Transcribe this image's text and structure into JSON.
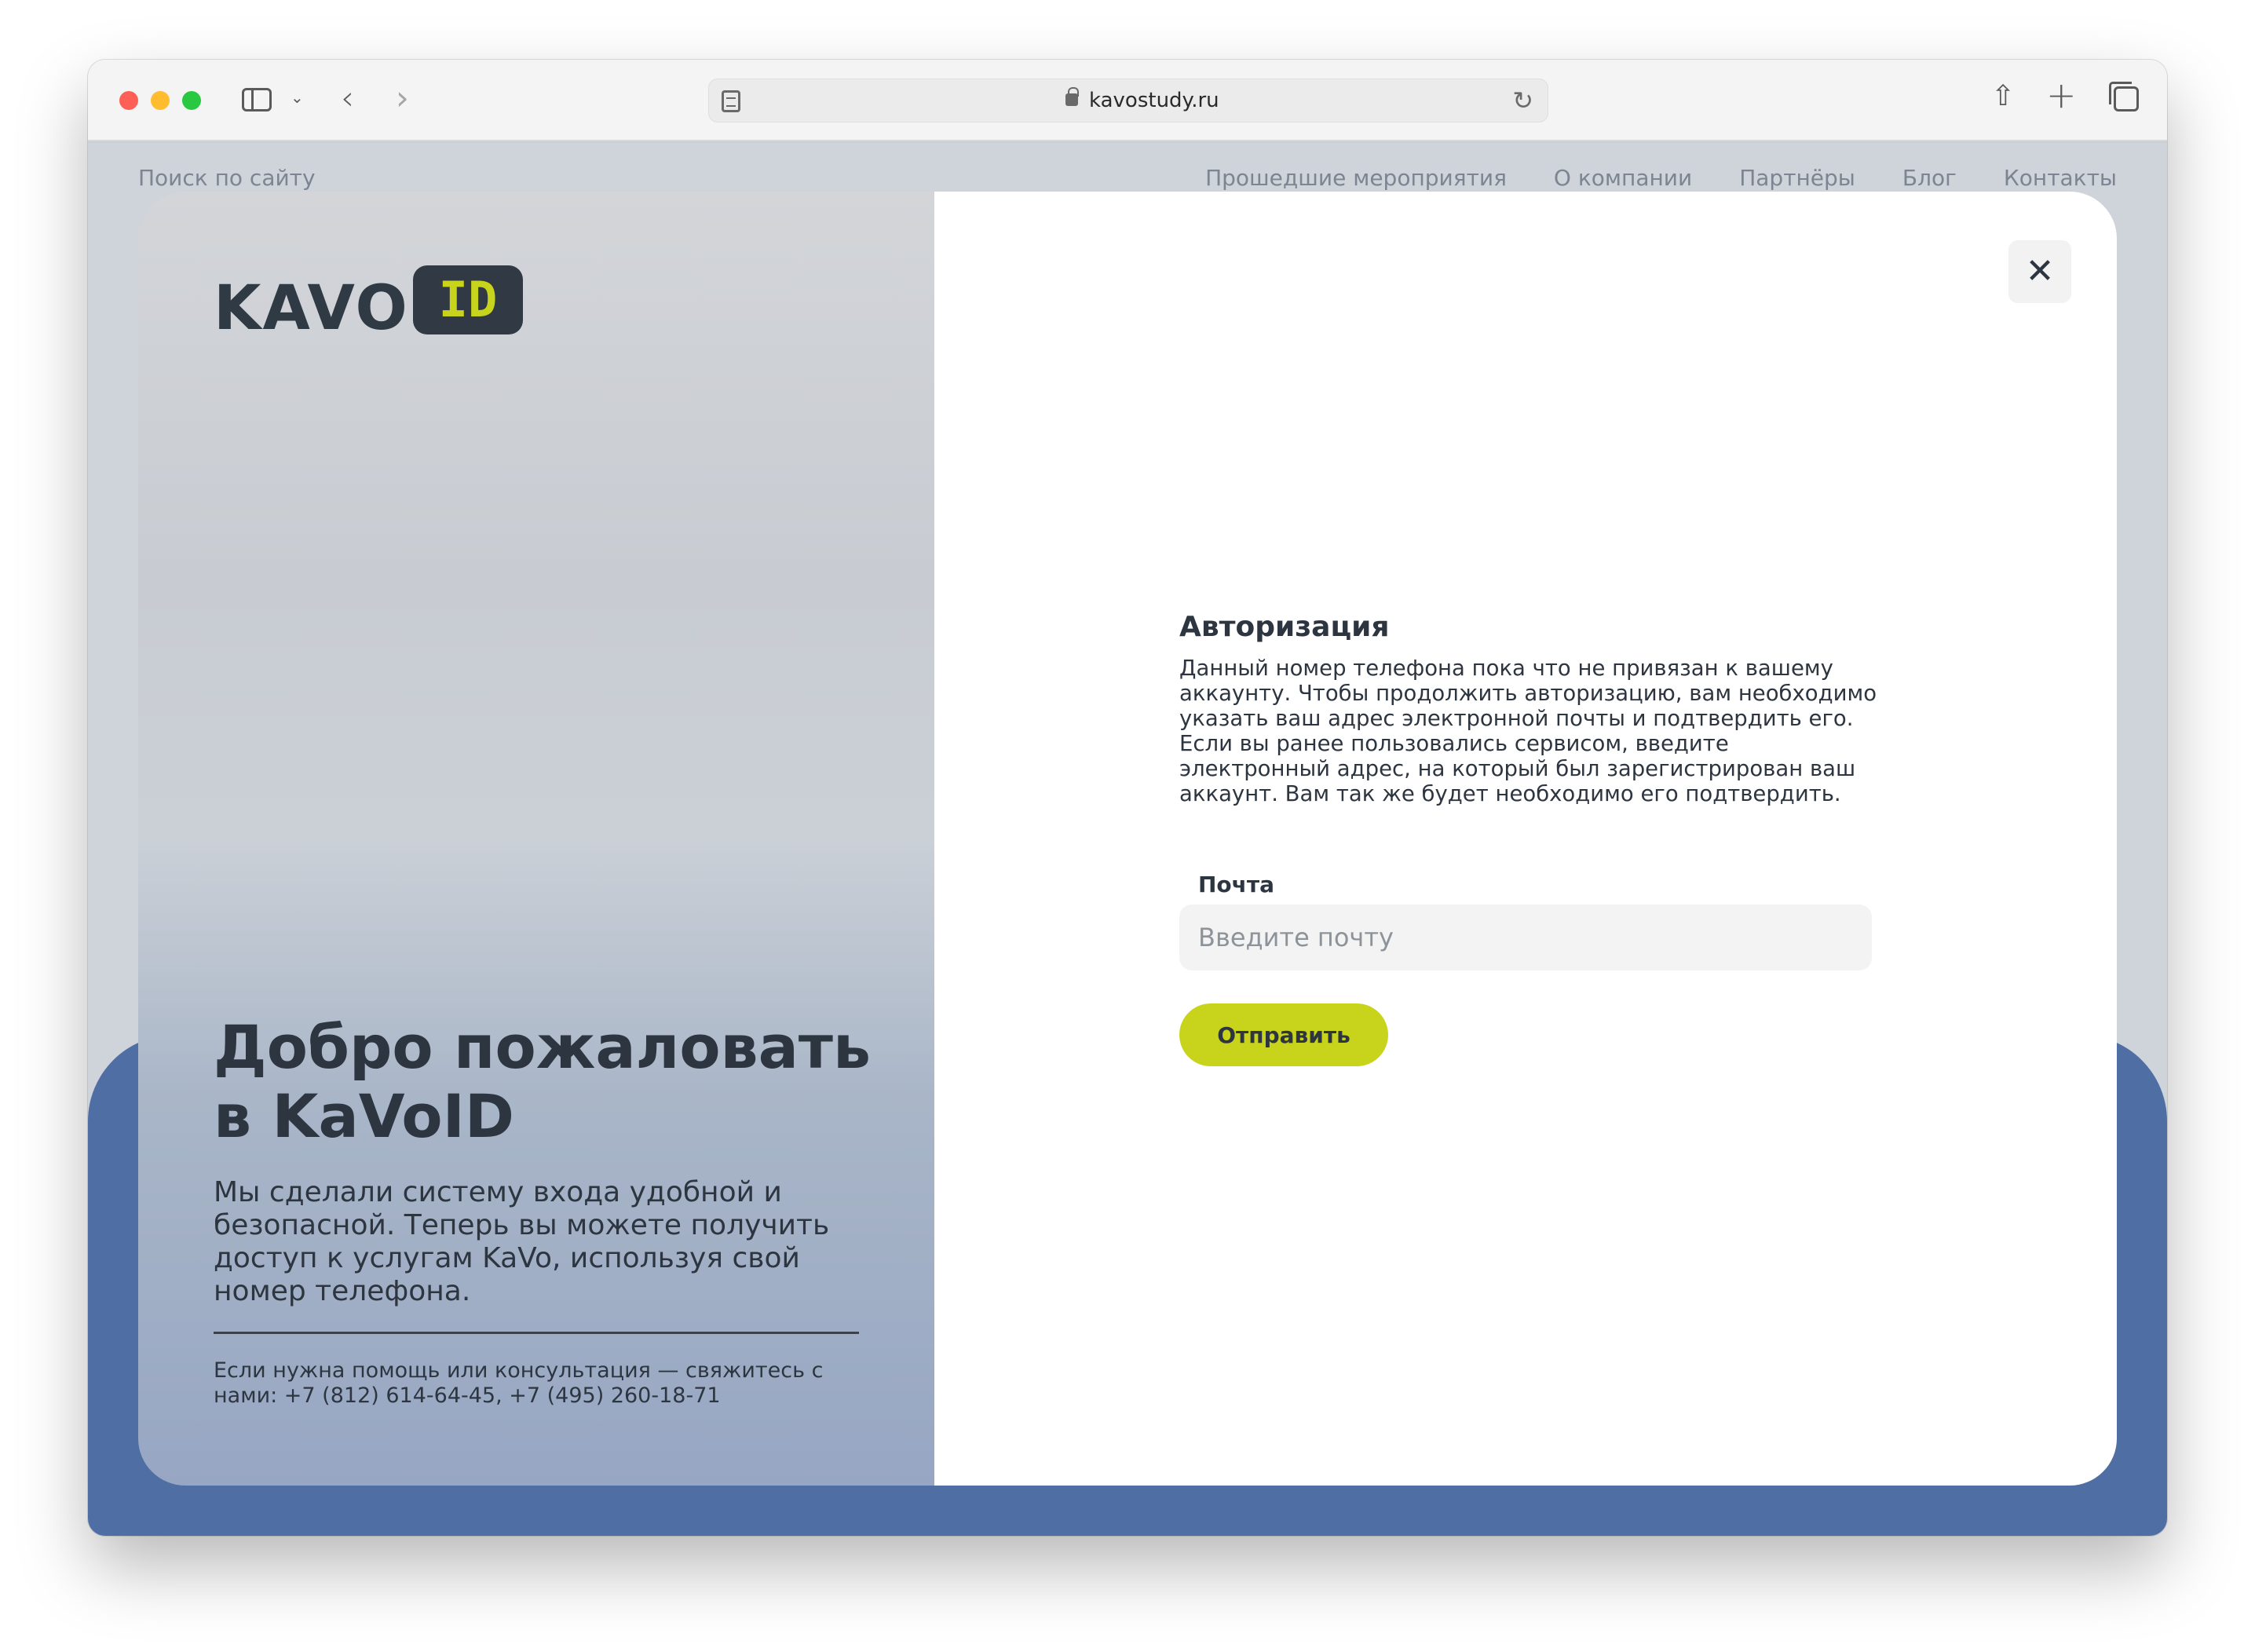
{
  "browser": {
    "url": "kavostudy.ru",
    "icons": [
      "sidebar-icon",
      "chevron-down-icon",
      "back-icon",
      "forward-icon",
      "reader-icon",
      "lock-icon",
      "reload-icon",
      "share-icon",
      "plus-icon",
      "tabs-icon"
    ]
  },
  "site_nav": {
    "search_label": "Поиск по сайту",
    "items": [
      "Прошедшие мероприятия",
      "О компании",
      "Партнёры",
      "Блог",
      "Контакты"
    ]
  },
  "modal": {
    "brand_kavo": "KAVO",
    "brand_id": "ID",
    "welcome_title": "Добро пожаловать в KaVoID",
    "welcome_text": "Мы сделали систему входа удобной и безопасной. Теперь вы можете получить доступ к услугам KaVo, используя свой номер телефона.",
    "help_text": "Если нужна помощь или консультация — свяжитесь с нами: +7 (812) 614-64-45, +7 (495) 260-18-71",
    "close_label": "✕",
    "auth_title": "Авторизация",
    "auth_text": "Данный номер телефона пока что не привязан к вашему аккаунту. Чтобы продолжить авторизацию, вам необходимо указать ваш адрес электронной почты и подтвердить его. Если вы ранее пользовались сервисом, введите электронный адрес, на который был зарегистрирован ваш аккаунт. Вам так же будет необходимо его подтвердить.",
    "email_label": "Почта",
    "email_value": "",
    "email_placeholder": "Введите почту",
    "submit_label": "Отправить"
  },
  "colors": {
    "accent": "#c8d41c",
    "dark": "#2d3640",
    "page_blue": "#4e6ea4"
  }
}
